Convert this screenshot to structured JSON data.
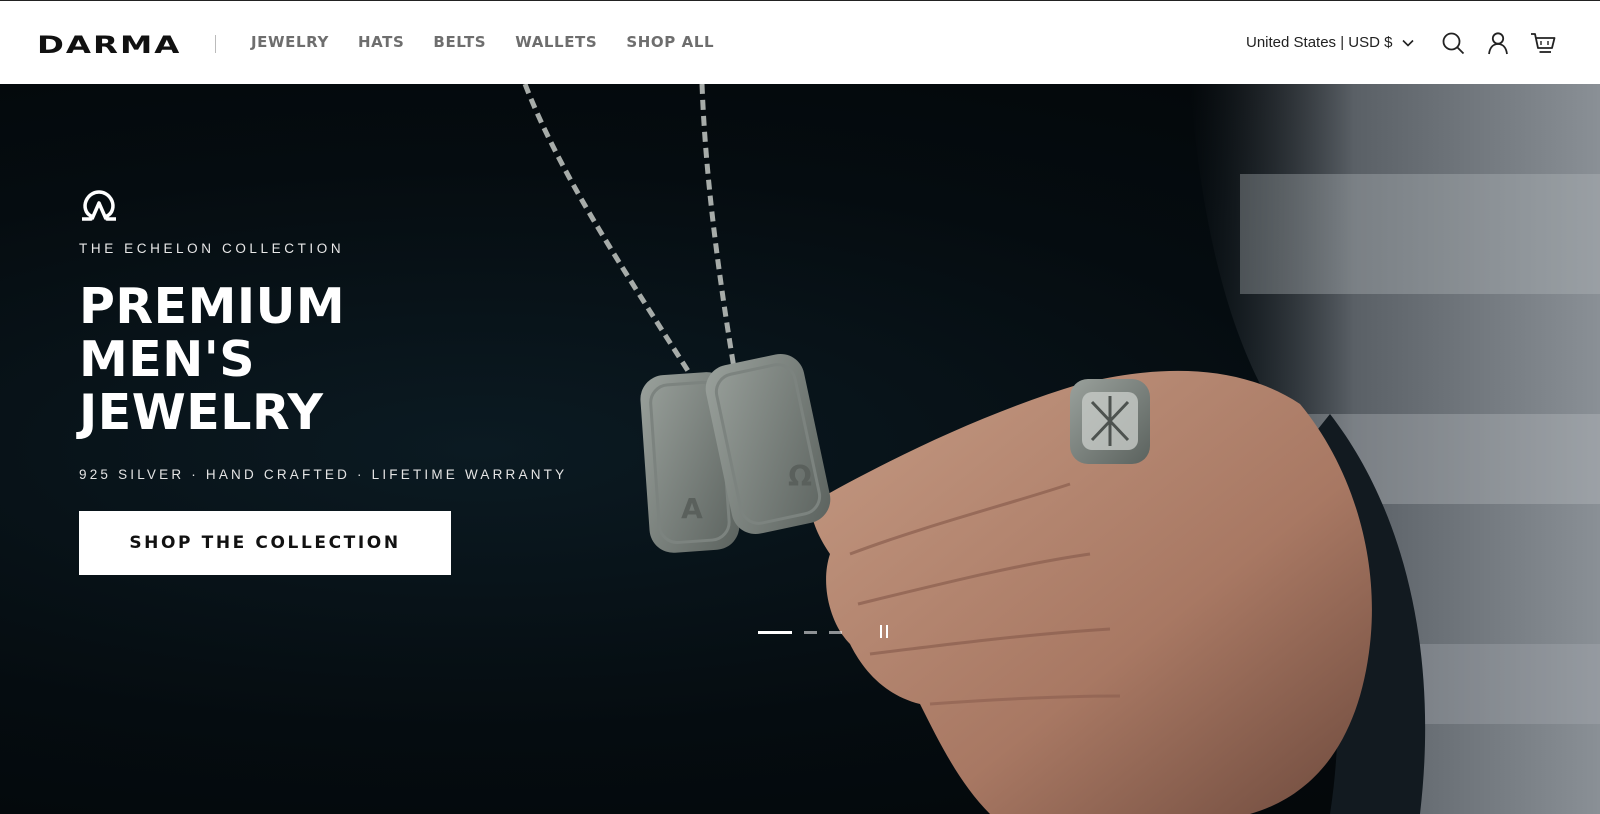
{
  "header": {
    "logo": "DARMA",
    "nav": [
      {
        "label": "JEWELRY"
      },
      {
        "label": "HATS"
      },
      {
        "label": "BELTS"
      },
      {
        "label": "WALLETS"
      },
      {
        "label": "SHOP ALL"
      }
    ],
    "locale": "United States | USD $",
    "icons": [
      "search-icon",
      "account-icon",
      "cart-icon"
    ]
  },
  "hero": {
    "eyebrow": "THE ECHELON COLLECTION",
    "headline": [
      "PREMIUM",
      "MEN'S",
      "JEWELRY"
    ],
    "subline": "925 SILVER · HAND CRAFTED · LIFETIME WARRANTY",
    "cta": "SHOP THE COLLECTION",
    "slides": {
      "count": 3,
      "active": 1
    },
    "tag_letters": [
      "A",
      "Ω"
    ],
    "brand_icon": "omega-logo-icon"
  },
  "colors": {
    "header_bg": "#ffffff",
    "nav_text": "#6e6e6e",
    "hero_bg": "#050c10",
    "cta_bg": "#ffffff",
    "cta_text": "#111111"
  }
}
